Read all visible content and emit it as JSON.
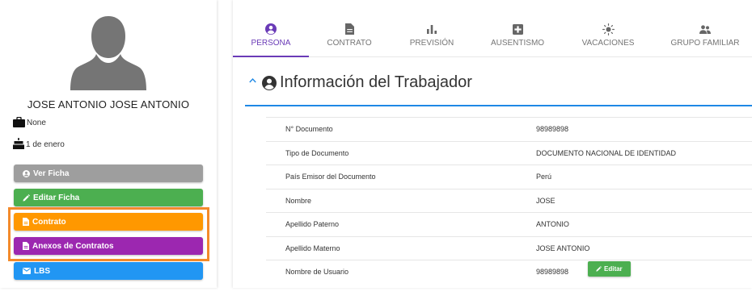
{
  "worker": {
    "name": "JOSE ANTONIO JOSE ANTONIO",
    "company": "None",
    "birthday": "1 de enero",
    "avatar_icon": "user-silhouette-icon"
  },
  "actions": {
    "ver_ficha": "Ver Ficha",
    "editar_ficha": "Editar Ficha",
    "contrato": "Contrato",
    "anexos": "Anexos de Contratos",
    "lbs": "LBS"
  },
  "tabs": [
    {
      "label": "PERSONA",
      "icon": "account-circle-icon",
      "active": true
    },
    {
      "label": "CONTRATO",
      "icon": "document-icon",
      "active": false
    },
    {
      "label": "PREVISIÓN",
      "icon": "bar-chart-icon",
      "active": false
    },
    {
      "label": "AUSENTISMO",
      "icon": "medical-plus-icon",
      "active": false
    },
    {
      "label": "VACACIONES",
      "icon": "sun-icon",
      "active": false
    },
    {
      "label": "GRUPO FAMILIAR",
      "icon": "family-icon",
      "active": false
    }
  ],
  "section": {
    "title": "Información del Trabajador",
    "collapse_icon": "chevron-up-icon"
  },
  "fields": [
    {
      "label": "N° Documento",
      "value": "98989898"
    },
    {
      "label": "Tipo de Documento",
      "value": "DOCUMENTO NACIONAL DE IDENTIDAD"
    },
    {
      "label": "País Emisor del Documento",
      "value": "Perú"
    },
    {
      "label": "Nombre",
      "value": "JOSE"
    },
    {
      "label": "Apellido Paterno",
      "value": "ANTONIO"
    },
    {
      "label": "Apellido Materno",
      "value": "JOSE ANTONIO"
    },
    {
      "label": "Nombre de Usuario",
      "value": "98989898",
      "edit_label": "Editar"
    }
  ],
  "colors": {
    "accent": "#6a3bb7",
    "section_line": "#1e88e5",
    "ver": "#9e9e9e",
    "editar": "#4caf50",
    "contrato": "#ff9800",
    "anexos": "#9c27b0",
    "lbs": "#2196f3",
    "highlight": "#f38a2b"
  }
}
